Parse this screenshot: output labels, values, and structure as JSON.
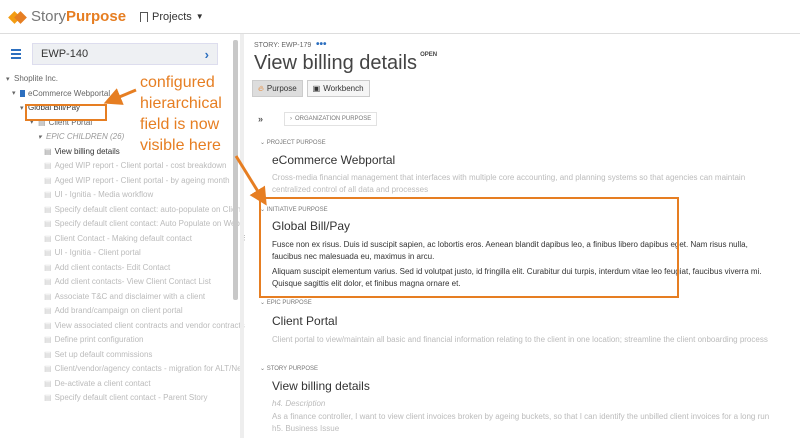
{
  "header": {
    "logo_part1": "Story",
    "logo_part2": "Purpose",
    "projects_label": "Projects"
  },
  "left": {
    "search_value": "EWP-140",
    "tree": [
      {
        "label": "Shoplite Inc.",
        "toggle": "▾",
        "glyph": ""
      },
      {
        "label": "eCommerce Webportal",
        "toggle": "▾",
        "glyph": "flag"
      },
      {
        "label": "Global Bill/Pay",
        "toggle": "▾",
        "glyph": ""
      },
      {
        "label": "Client Portal",
        "toggle": "▾",
        "glyph": "▤"
      },
      {
        "label": "EPIC CHILDREN (26)",
        "toggle": "▾",
        "glyph": ""
      },
      {
        "label": "View billing details",
        "glyph": "▤"
      },
      {
        "label": "Aged WIP report - Client portal - cost breakdown",
        "glyph": "▤"
      },
      {
        "label": "Aged WIP report - Client portal - by ageing month",
        "glyph": "▤"
      },
      {
        "label": "UI - Ignitia - Media workflow",
        "glyph": "▤"
      },
      {
        "label": "Specify default client contact: auto-populate on Client",
        "glyph": "▤"
      },
      {
        "label": "Specify default client contact: Auto Populate on Web",
        "glyph": "▤"
      },
      {
        "label": "Client Contact - Making default contact",
        "glyph": "▤"
      },
      {
        "label": "UI - Ignitia - Client portal",
        "glyph": "▤"
      },
      {
        "label": "Add client contacts- Edit Contact",
        "glyph": "▤"
      },
      {
        "label": "Add client contacts- View Client Contact List",
        "glyph": "▤"
      },
      {
        "label": "Associate T&C and disclaimer with a client",
        "glyph": "▤"
      },
      {
        "label": "Add brand/campaign on client portal",
        "glyph": "▤"
      },
      {
        "label": "View associated client contracts and vendor contracts",
        "glyph": "▤"
      },
      {
        "label": "Define print configuration",
        "glyph": "▤"
      },
      {
        "label": "Set up default commissions",
        "glyph": "▤"
      },
      {
        "label": "Client/vendor/agency contacts - migration for ALT/Ne",
        "glyph": "▤"
      },
      {
        "label": "De-activate a client contact",
        "glyph": "▤"
      },
      {
        "label": "Specify default client contact - Parent Story",
        "glyph": "▤"
      }
    ]
  },
  "main": {
    "story_id": "STORY: EWP-179",
    "title": "View billing details",
    "status": "OPEN",
    "tabs": {
      "purpose": "Purpose",
      "workbench": "Workbench"
    },
    "org_purpose": "ORGANIZATION PURPOSE",
    "sections": {
      "project": {
        "label": "PROJECT PURPOSE",
        "title": "eCommerce Webportal",
        "body": "Cross-media financial management that interfaces with multiple core accounting, and planning systems so that agencies can maintain centralized control of all data and processes"
      },
      "initiative": {
        "label": "INITIATIVE PURPOSE",
        "title": "Global Bill/Pay",
        "body1": "Fusce non ex risus. Duis id suscipit sapien, ac lobortis eros. Aenean blandit dapibus leo, a finibus libero dapibus eget. Nam risus nulla, faucibus nec malesuada eu, maximus in arcu.",
        "body2": "Aliquam suscipit elementum varius. Sed id volutpat justo, id fringilla elit. Curabitur dui turpis, interdum vitae leo feugiat, faucibus viverra mi. Quisque sagittis elit dolor, et finibus magna ornare et."
      },
      "epic": {
        "label": "EPIC PURPOSE",
        "title": "Client Portal",
        "body": "Client portal to view/maintain all basic and financial information relating to the client in one location; streamline the client onboarding process"
      },
      "story": {
        "label": "STORY PURPOSE",
        "title": "View billing details",
        "h4": "h4. Description",
        "body": "As a finance controller, I want to view client invoices broken by ageing buckets, so that I can identify the unbilled client invoices for a long run h5. Business Issue"
      }
    }
  },
  "annotation": {
    "text": "configured hierarchical field is now visible here",
    "color": "#e67e22"
  }
}
